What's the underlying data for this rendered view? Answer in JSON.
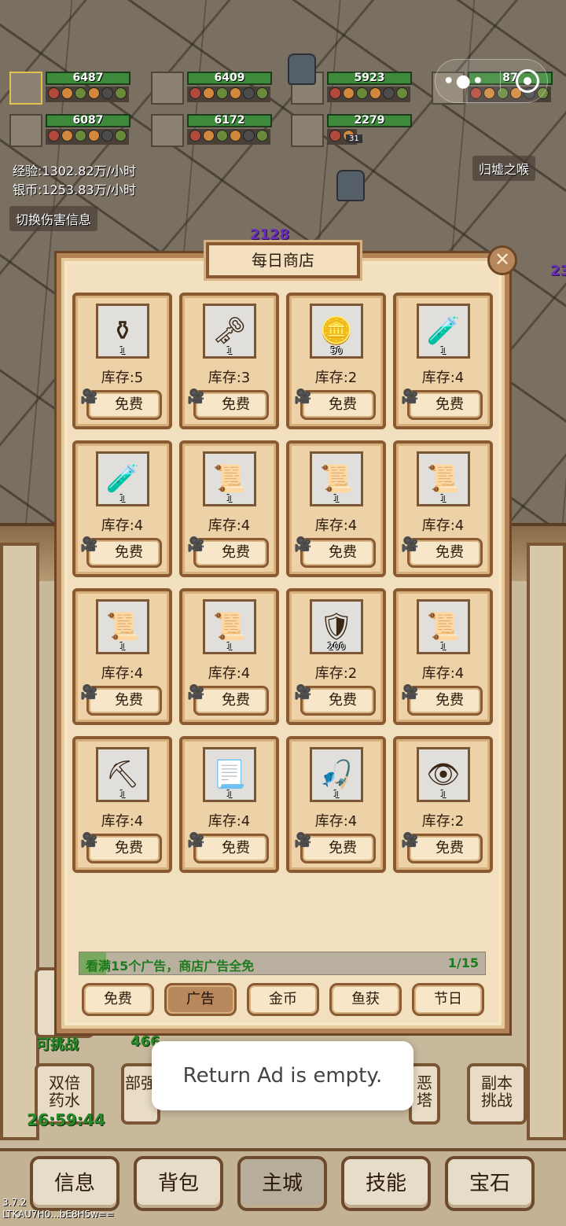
{
  "heroes": [
    {
      "hp": "6487",
      "selected": true
    },
    {
      "hp": "6409",
      "selected": false
    },
    {
      "hp": "5923",
      "selected": false
    },
    {
      "hp": "87",
      "selected": false
    },
    {
      "hp": "6087",
      "selected": false
    },
    {
      "hp": "6172",
      "selected": false
    },
    {
      "hp": "2279",
      "selected": false,
      "level": "31"
    }
  ],
  "stats": {
    "exp": "经验:1302.82万/小时",
    "silver": "银币:1253.83万/小时",
    "toggle_damage": "切换伤害信息",
    "zone": "归墟之喉"
  },
  "damage_numbers": [
    "2128",
    "23"
  ],
  "shop": {
    "title": "每日商店",
    "items": [
      {
        "icon": "potion-gold-icon",
        "glyph": "⚱",
        "qty": "1",
        "stock": "库存:5",
        "price": "免费"
      },
      {
        "icon": "key-icon",
        "glyph": "🗝",
        "qty": "1",
        "stock": "库存:3",
        "price": "免费"
      },
      {
        "icon": "gold-coin-icon",
        "glyph": "🪙",
        "qty": "50",
        "stock": "库存:2",
        "price": "免费"
      },
      {
        "icon": "potion-yellow-icon",
        "glyph": "🧪",
        "qty": "1",
        "stock": "库存:4",
        "price": "免费"
      },
      {
        "icon": "potion-green-icon",
        "glyph": "🧪",
        "qty": "1",
        "stock": "库存:4",
        "price": "免费"
      },
      {
        "icon": "scroll-green-icon",
        "glyph": "📜",
        "qty": "1",
        "stock": "库存:4",
        "price": "免费"
      },
      {
        "icon": "scroll-red-icon",
        "glyph": "📜",
        "qty": "1",
        "stock": "库存:4",
        "price": "免费"
      },
      {
        "icon": "scroll-orange-icon",
        "glyph": "📜",
        "qty": "1",
        "stock": "库存:4",
        "price": "免费"
      },
      {
        "icon": "scroll-blue-icon",
        "glyph": "📜",
        "qty": "1",
        "stock": "库存:4",
        "price": "免费"
      },
      {
        "icon": "scroll-purple-icon",
        "glyph": "📜",
        "qty": "1",
        "stock": "库存:4",
        "price": "免费"
      },
      {
        "icon": "shield-icon",
        "glyph": "🛡",
        "qty": "200",
        "stock": "库存:2",
        "price": "免费"
      },
      {
        "icon": "scroll-plain-icon",
        "glyph": "📜",
        "qty": "1",
        "stock": "库存:4",
        "price": "免费"
      },
      {
        "icon": "pickaxe-icon",
        "glyph": "⛏",
        "qty": "1",
        "stock": "库存:4",
        "price": "免费"
      },
      {
        "icon": "paper-scroll-icon",
        "glyph": "📃",
        "qty": "1",
        "stock": "库存:4",
        "price": "免费"
      },
      {
        "icon": "fishing-rod-icon",
        "glyph": "🎣",
        "qty": "1",
        "stock": "库存:4",
        "price": "免费"
      },
      {
        "icon": "green-eye-icon",
        "glyph": "👁",
        "qty": "1",
        "stock": "库存:2",
        "price": "免费"
      }
    ],
    "ad_progress": {
      "text": "看满15个广告，商店广告全免",
      "count": "1/15",
      "fraction": 0.0667
    },
    "tabs": [
      {
        "label": "免费",
        "active": false
      },
      {
        "label": "广告",
        "active": true
      },
      {
        "label": "金币",
        "active": false
      },
      {
        "label": "鱼获",
        "active": false
      },
      {
        "label": "节日",
        "active": false
      }
    ]
  },
  "under_panel": {
    "double_potion": "双倍药水",
    "double_timer": "26:59:44",
    "dungeon": "副本挑战",
    "challengeable": "可挑战",
    "number": "466",
    "partial_left": "部强",
    "partial_right": "恶塔"
  },
  "toast": "Return Ad is empty.",
  "nav": [
    {
      "label": "信息",
      "active": false
    },
    {
      "label": "背包",
      "active": false
    },
    {
      "label": "主城",
      "active": true
    },
    {
      "label": "技能",
      "active": false
    },
    {
      "label": "宝石",
      "active": false
    }
  ],
  "version": {
    "number": "3.7.2",
    "code": "LTKAU7H0...bE8H5w=="
  }
}
